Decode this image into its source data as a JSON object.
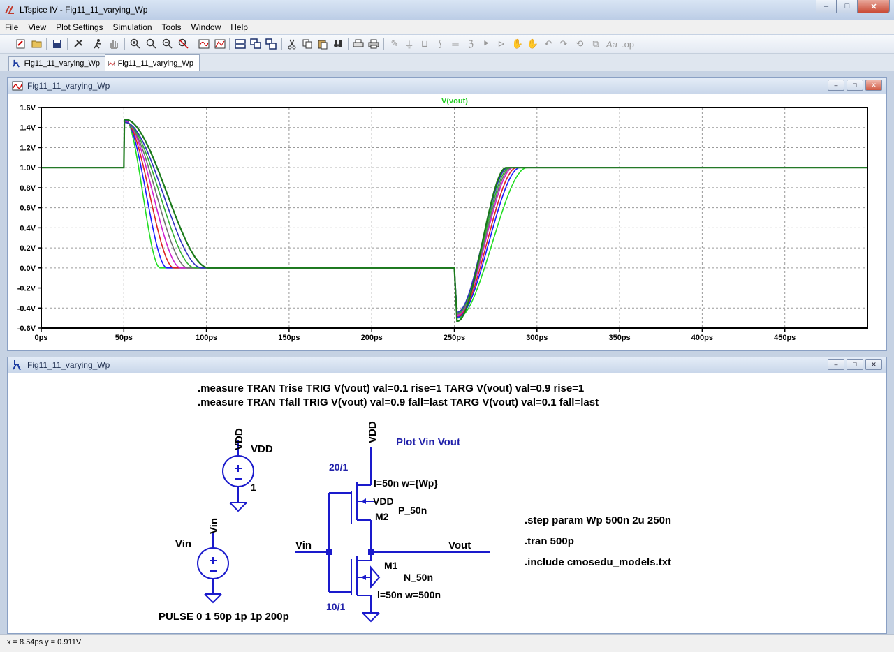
{
  "window": {
    "title": "LTspice IV - Fig11_11_varying_Wp",
    "minimize": "–",
    "maximize": "□",
    "close": "✕"
  },
  "menu": [
    "File",
    "View",
    "Plot Settings",
    "Simulation",
    "Tools",
    "Window",
    "Help"
  ],
  "toolbar_icons": [
    "new-schematic-icon",
    "open-folder-icon",
    "save-icon",
    "control-panel-icon",
    "run-icon",
    "halt-icon",
    "zoom-in-icon",
    "zoom-extents-icon",
    "zoom-out-icon",
    "zoom-cancel-icon",
    "autorange-icon",
    "pick-visible-traces-icon",
    "tile-horizontal-icon",
    "cascade-icon",
    "tile-vertical-icon",
    "cut-icon",
    "copy-icon",
    "paste-icon",
    "find-icon",
    "print-setup-icon",
    "print-icon",
    "wire-icon",
    "ground-icon",
    "label-icon",
    "resistor-icon",
    "capacitor-icon",
    "inductor-icon",
    "diode-icon",
    "component-icon",
    "move-icon",
    "drag-icon",
    "undo-icon",
    "redo-icon",
    "rotate-icon",
    "mirror-icon",
    "text-icon",
    "spice-directive-icon"
  ],
  "tabs": [
    {
      "label": "Fig11_11_varying_Wp",
      "icon": "schematic-icon"
    },
    {
      "label": "Fig11_11_varying_Wp",
      "icon": "waveform-icon"
    }
  ],
  "plot_window": {
    "title": "Fig11_11_varying_Wp"
  },
  "schematic_window": {
    "title": "Fig11_11_varying_Wp"
  },
  "chart_data": {
    "type": "line",
    "trace_label": "V(vout)",
    "xlabel": "",
    "ylabel": "",
    "xlim": [
      0,
      500
    ],
    "ylim": [
      -0.6,
      1.6
    ],
    "x_ticks": [
      "0ps",
      "50ps",
      "100ps",
      "150ps",
      "200ps",
      "250ps",
      "300ps",
      "350ps",
      "400ps",
      "450ps"
    ],
    "y_ticks": [
      "1.6V",
      "1.4V",
      "1.2V",
      "1.0V",
      "0.8V",
      "0.6V",
      "0.4V",
      "0.2V",
      "0.0V",
      "-0.2V",
      "-0.4V",
      "-0.6V"
    ],
    "grid": true,
    "series": [
      {
        "color": "#22dd22",
        "tfall": 10,
        "trise": 20,
        "peak": 1.48,
        "dip": -0.5
      },
      {
        "color": "#1a1aff",
        "tfall": 12,
        "trise": 18,
        "peak": 1.47,
        "dip": -0.49
      },
      {
        "color": "#dd2222",
        "tfall": 14,
        "trise": 17,
        "peak": 1.46,
        "dip": -0.48
      },
      {
        "color": "#d020d0",
        "tfall": 16,
        "trise": 16,
        "peak": 1.46,
        "dip": -0.47
      },
      {
        "color": "#707070",
        "tfall": 18,
        "trise": 15.5,
        "peak": 1.45,
        "dip": -0.46
      },
      {
        "color": "#30b030",
        "tfall": 20,
        "trise": 15,
        "peak": 1.45,
        "dip": -0.45
      },
      {
        "color": "#3030c0",
        "tfall": 22,
        "trise": 14.5,
        "peak": 1.45,
        "dip": -0.44
      },
      {
        "color": "#1a7a1a",
        "tfall": 24,
        "trise": 14,
        "peak": 1.48,
        "dip": -0.53
      }
    ]
  },
  "schematic": {
    "directives": [
      ".measure TRAN Trise TRIG V(vout) val=0.1 rise=1 TARG V(vout) val=0.9 rise=1",
      ".measure TRAN Tfall TRIG V(vout) val=0.9 fall=last TARG V(vout) val=0.1 fall=last"
    ],
    "vdd_net": "VDD",
    "vdd_source_name": "VDD",
    "vdd_source_value": "1",
    "vin_net": "Vin",
    "vin_source_name": "Vin",
    "vin_source_value": "PULSE 0 1 50p 1p 1p 200p",
    "plot_label": "Plot Vin Vout",
    "pmos_ratio": "20/1",
    "pmos_params": "l=50n w={Wp}",
    "pmos_body": "VDD",
    "pmos_name": "M2",
    "pmos_model": "P_50n",
    "nmos_ratio": "10/1",
    "nmos_params": "l=50n w=500n",
    "nmos_name": "M1",
    "nmos_model": "N_50n",
    "in_label": "Vin",
    "out_label": "Vout",
    "top_vdd": "VDD",
    "sim_directives": [
      ".step param Wp 500n 2u 250n",
      ".tran 500p",
      ".include cmosedu_models.txt"
    ]
  },
  "status": "x = 8.54ps    y = 0.911V"
}
